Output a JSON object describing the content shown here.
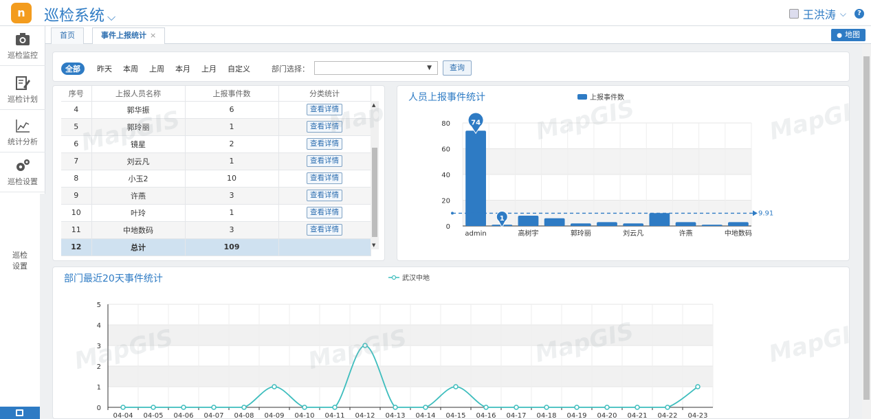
{
  "app": {
    "title": "巡检系统",
    "logo_text": "n",
    "user": "王洪涛"
  },
  "sidebar": {
    "items": [
      {
        "label": "巡检监控",
        "icon": "camera-icon"
      },
      {
        "label": "巡检计划",
        "icon": "edit-icon"
      },
      {
        "label": "统计分析",
        "icon": "line-chart-icon"
      },
      {
        "label": "巡检设置",
        "icon": "gears-icon"
      }
    ],
    "extra_label": "巡检设置"
  },
  "tabs": [
    {
      "label": "首页",
      "active": false
    },
    {
      "label": "事件上报统计",
      "active": true,
      "close": "×"
    }
  ],
  "map_button": "地图",
  "filter": {
    "options": [
      "全部",
      "昨天",
      "本周",
      "上周",
      "本月",
      "上月",
      "自定义"
    ],
    "active": "全部",
    "dept_label": "部门选择：",
    "dept_value": "",
    "query_label": "查询"
  },
  "table": {
    "headers": [
      "序号",
      "上报人员名称",
      "上报事件数",
      "分类统计"
    ],
    "detail_label": "查看详情",
    "rows": [
      {
        "no": "4",
        "name": "郭华振",
        "count": "6"
      },
      {
        "no": "5",
        "name": "郭玲丽",
        "count": "1"
      },
      {
        "no": "6",
        "name": "镜星",
        "count": "2"
      },
      {
        "no": "7",
        "name": "刘云凡",
        "count": "1"
      },
      {
        "no": "8",
        "name": "小玉2",
        "count": "10"
      },
      {
        "no": "9",
        "name": "许燕",
        "count": "3"
      },
      {
        "no": "10",
        "name": "叶玲",
        "count": "1"
      },
      {
        "no": "11",
        "name": "中地数码",
        "count": "3"
      }
    ],
    "total": {
      "no": "12",
      "name": "总计",
      "count": "109"
    }
  },
  "watermark": "MapGIS",
  "chart_data": [
    {
      "type": "bar",
      "title": "人员上报事件统计",
      "legend": [
        "上报事件数"
      ],
      "legend_position": "top-center",
      "categories": [
        "admin",
        "",
        "高树宇",
        "",
        "郭玲丽",
        "",
        "刘云凡",
        "",
        "许燕",
        "",
        "中地数码"
      ],
      "series": [
        {
          "name": "上报事件数",
          "values": [
            74,
            1,
            8,
            6,
            2,
            3,
            2,
            10,
            3,
            1,
            3
          ]
        }
      ],
      "ylim": [
        0,
        80
      ],
      "yticks": [
        0,
        20,
        40,
        60,
        80
      ],
      "max_marker": {
        "label": "74",
        "value": 74
      },
      "min_marker": {
        "label": "1",
        "value": 1
      },
      "average_line": {
        "value": 9.91,
        "label": "9.91"
      },
      "grid": true,
      "color": "#2e7bc4"
    },
    {
      "type": "line",
      "title": "部门最近20天事件统计",
      "legend": [
        "武汉中地"
      ],
      "legend_position": "top-center",
      "x": [
        "04-04",
        "04-05",
        "04-06",
        "04-07",
        "04-08",
        "04-09",
        "04-10",
        "04-11",
        "04-12",
        "04-13",
        "04-14",
        "04-15",
        "04-16",
        "04-17",
        "04-18",
        "04-19",
        "04-20",
        "04-21",
        "04-22",
        "04-23"
      ],
      "series": [
        {
          "name": "武汉中地",
          "values": [
            0,
            0,
            0,
            0,
            0,
            1,
            0,
            0,
            3,
            0,
            0,
            1,
            0,
            0,
            0,
            0,
            0,
            0,
            0,
            1
          ]
        }
      ],
      "ylim": [
        0,
        5
      ],
      "yticks": [
        0,
        1,
        2,
        3,
        4,
        5
      ],
      "grid": true,
      "color": "#3dbdbd"
    }
  ]
}
